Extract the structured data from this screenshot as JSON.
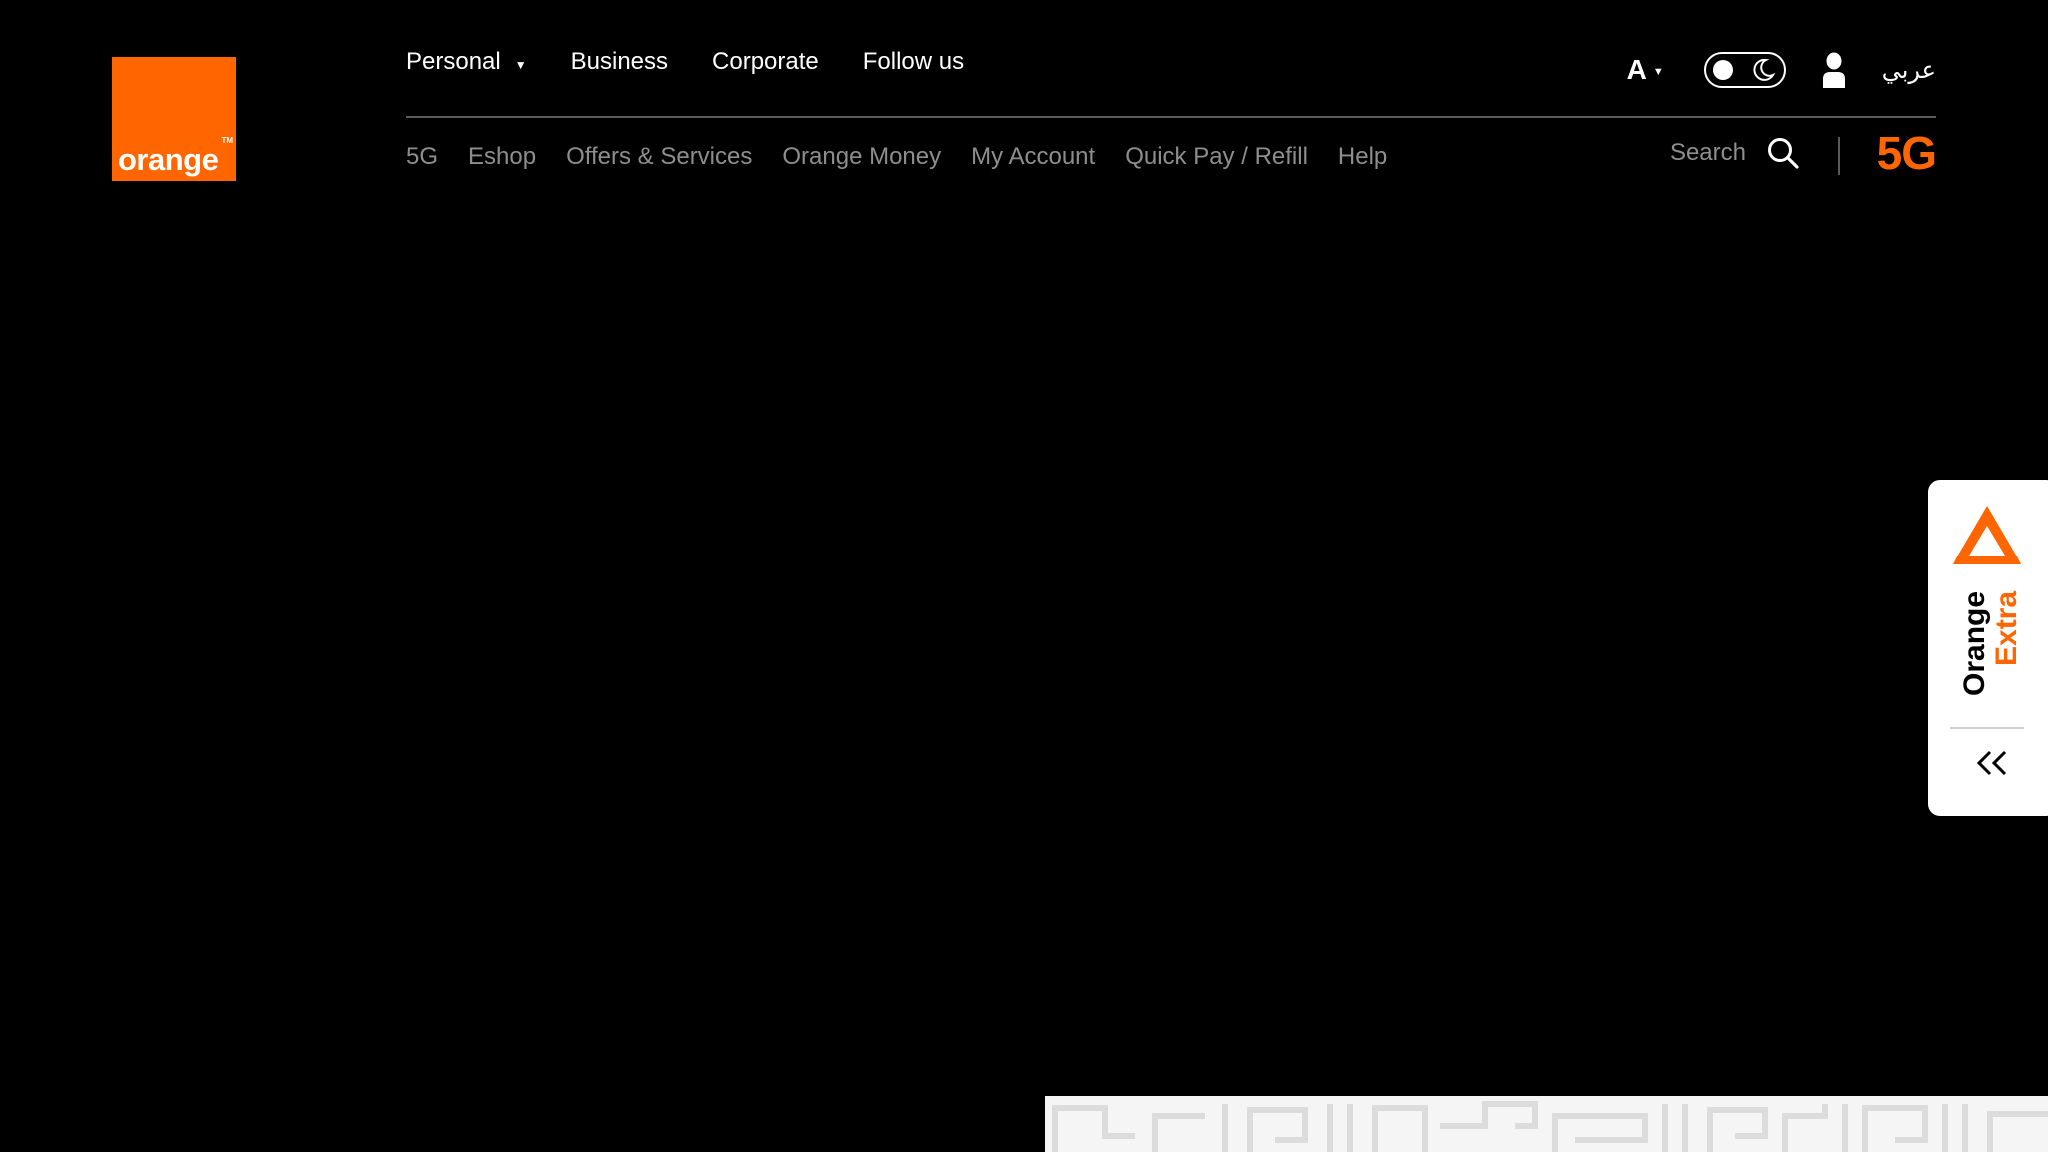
{
  "brand": {
    "logo_text": "orange",
    "logo_tm": "TM",
    "accent_color": "#ff6600"
  },
  "top_nav": {
    "items": [
      {
        "label": "Personal",
        "has_dropdown": true
      },
      {
        "label": "Business"
      },
      {
        "label": "Corporate"
      },
      {
        "label": "Follow us"
      }
    ]
  },
  "utilities": {
    "font_size_label": "A",
    "theme_toggle_icon": "moon-icon",
    "user_icon": "user-icon",
    "language_label": "عربي"
  },
  "sub_nav": {
    "items": [
      {
        "label": "5G"
      },
      {
        "label": "Eshop"
      },
      {
        "label": "Offers & Services"
      },
      {
        "label": "Orange Money"
      },
      {
        "label": "My Account"
      },
      {
        "label": "Quick Pay / Refill"
      },
      {
        "label": "Help"
      }
    ]
  },
  "search": {
    "label": "Search",
    "icon": "search-icon"
  },
  "badge": {
    "label": "5G"
  },
  "extra_widget": {
    "line1": "Orange",
    "line2": "Extra",
    "collapse_icon": "double-chevron-left-icon"
  }
}
